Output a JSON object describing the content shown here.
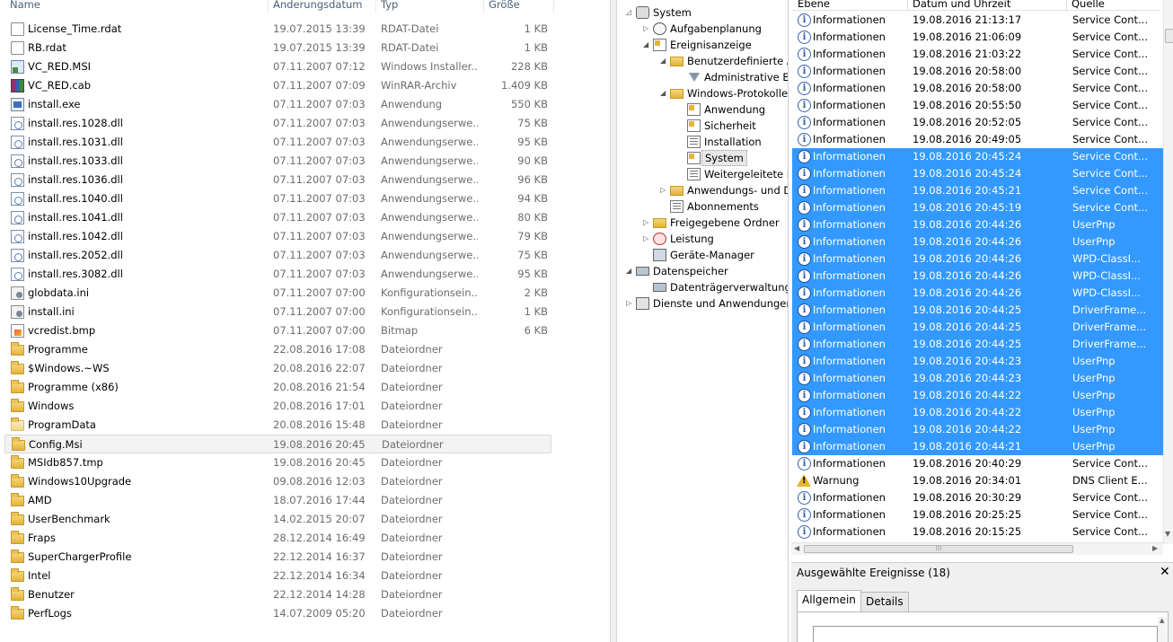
{
  "explorer": {
    "columns": {
      "name": "Name",
      "date": "Änderungsdatum",
      "type": "Typ",
      "size": "Größe"
    },
    "files": [
      {
        "icon": "file-icon",
        "name": "License_Time.rdat",
        "date": "19.07.2015 13:39",
        "type": "RDAT-Datei",
        "size": "1 KB"
      },
      {
        "icon": "file-icon",
        "name": "RB.rdat",
        "date": "19.07.2015 13:39",
        "type": "RDAT-Datei",
        "size": "1 KB"
      },
      {
        "icon": "msi-icon",
        "name": "VC_RED.MSI",
        "date": "07.11.2007 07:12",
        "type": "Windows Installer...",
        "size": "228 KB"
      },
      {
        "icon": "cab-icon",
        "name": "VC_RED.cab",
        "date": "07.11.2007 07:09",
        "type": "WinRAR-Archiv",
        "size": "1.409 KB"
      },
      {
        "icon": "exe-icon",
        "name": "install.exe",
        "date": "07.11.2007 07:03",
        "type": "Anwendung",
        "size": "550 KB"
      },
      {
        "icon": "dll-icon",
        "name": "install.res.1028.dll",
        "date": "07.11.2007 07:03",
        "type": "Anwendungserwe...",
        "size": "75 KB"
      },
      {
        "icon": "dll-icon",
        "name": "install.res.1031.dll",
        "date": "07.11.2007 07:03",
        "type": "Anwendungserwe...",
        "size": "95 KB"
      },
      {
        "icon": "dll-icon",
        "name": "install.res.1033.dll",
        "date": "07.11.2007 07:03",
        "type": "Anwendungserwe...",
        "size": "90 KB"
      },
      {
        "icon": "dll-icon",
        "name": "install.res.1036.dll",
        "date": "07.11.2007 07:03",
        "type": "Anwendungserwe...",
        "size": "96 KB"
      },
      {
        "icon": "dll-icon",
        "name": "install.res.1040.dll",
        "date": "07.11.2007 07:03",
        "type": "Anwendungserwe...",
        "size": "94 KB"
      },
      {
        "icon": "dll-icon",
        "name": "install.res.1041.dll",
        "date": "07.11.2007 07:03",
        "type": "Anwendungserwe...",
        "size": "80 KB"
      },
      {
        "icon": "dll-icon",
        "name": "install.res.1042.dll",
        "date": "07.11.2007 07:03",
        "type": "Anwendungserwe...",
        "size": "79 KB"
      },
      {
        "icon": "dll-icon",
        "name": "install.res.2052.dll",
        "date": "07.11.2007 07:03",
        "type": "Anwendungserwe...",
        "size": "75 KB"
      },
      {
        "icon": "dll-icon",
        "name": "install.res.3082.dll",
        "date": "07.11.2007 07:03",
        "type": "Anwendungserwe...",
        "size": "95 KB"
      },
      {
        "icon": "ini-icon",
        "name": "globdata.ini",
        "date": "07.11.2007 07:00",
        "type": "Konfigurationsein...",
        "size": "2 KB"
      },
      {
        "icon": "ini-icon",
        "name": "install.ini",
        "date": "07.11.2007 07:00",
        "type": "Konfigurationsein...",
        "size": "1 KB"
      },
      {
        "icon": "bmp-icon",
        "name": "vcredist.bmp",
        "date": "07.11.2007 07:00",
        "type": "Bitmap",
        "size": "6 KB"
      },
      {
        "icon": "folder-icon",
        "name": "Programme",
        "date": "22.08.2016 17:08",
        "type": "Dateiordner",
        "size": ""
      },
      {
        "icon": "folder-icon",
        "name": "$Windows.~WS",
        "date": "20.08.2016 22:07",
        "type": "Dateiordner",
        "size": ""
      },
      {
        "icon": "folder-icon",
        "name": "Programme (x86)",
        "date": "20.08.2016 21:54",
        "type": "Dateiordner",
        "size": ""
      },
      {
        "icon": "folder-icon",
        "name": "Windows",
        "date": "20.08.2016 17:01",
        "type": "Dateiordner",
        "size": ""
      },
      {
        "icon": "folder-light-icon",
        "name": "ProgramData",
        "date": "20.08.2016 15:48",
        "type": "Dateiordner",
        "size": ""
      },
      {
        "icon": "folder-icon",
        "name": "Config.Msi",
        "date": "19.08.2016 20:45",
        "type": "Dateiordner",
        "size": "",
        "selected": true
      },
      {
        "icon": "folder-icon",
        "name": "MSIdb857.tmp",
        "date": "19.08.2016 20:45",
        "type": "Dateiordner",
        "size": ""
      },
      {
        "icon": "folder-icon",
        "name": "Windows10Upgrade",
        "date": "09.08.2016 12:03",
        "type": "Dateiordner",
        "size": ""
      },
      {
        "icon": "folder-icon",
        "name": "AMD",
        "date": "18.07.2016 17:44",
        "type": "Dateiordner",
        "size": ""
      },
      {
        "icon": "folder-icon",
        "name": "UserBenchmark",
        "date": "14.02.2015 20:07",
        "type": "Dateiordner",
        "size": ""
      },
      {
        "icon": "folder-icon",
        "name": "Fraps",
        "date": "28.12.2014 16:49",
        "type": "Dateiordner",
        "size": ""
      },
      {
        "icon": "folder-icon",
        "name": "SuperChargerProfile",
        "date": "22.12.2014 16:37",
        "type": "Dateiordner",
        "size": ""
      },
      {
        "icon": "folder-icon",
        "name": "Intel",
        "date": "22.12.2014 16:34",
        "type": "Dateiordner",
        "size": ""
      },
      {
        "icon": "folder-icon",
        "name": "Benutzer",
        "date": "22.12.2014 14:28",
        "type": "Dateiordner",
        "size": ""
      },
      {
        "icon": "folder-icon",
        "name": "PerfLogs",
        "date": "14.07.2009 05:20",
        "type": "Dateiordner",
        "size": ""
      }
    ]
  },
  "tree": {
    "items": [
      {
        "label": "System",
        "icon": "system-tools-icon",
        "expander": "◿",
        "level": 0
      },
      {
        "label": "Aufgabenplanung",
        "icon": "task-scheduler-icon",
        "expander": "▷",
        "level": 1
      },
      {
        "label": "Ereignisanzeige",
        "icon": "event-viewer-icon",
        "expander": "◢",
        "level": 1
      },
      {
        "label": "Benutzerdefinierte A",
        "icon": "folder-icon",
        "expander": "◢",
        "level": 2
      },
      {
        "label": "Administrative E",
        "icon": "filter-icon",
        "expander": "",
        "level": 3
      },
      {
        "label": "Windows-Protokolle",
        "icon": "folder-icon",
        "expander": "◢",
        "level": 2
      },
      {
        "label": "Anwendung",
        "icon": "log-icon",
        "expander": "",
        "level": 3
      },
      {
        "label": "Sicherheit",
        "icon": "log-icon",
        "expander": "",
        "level": 3
      },
      {
        "label": "Installation",
        "icon": "log-plain-icon",
        "expander": "",
        "level": 3
      },
      {
        "label": "System",
        "icon": "log-icon",
        "expander": "",
        "level": 3,
        "selected": true
      },
      {
        "label": "Weitergeleitete E",
        "icon": "log-plain-icon",
        "expander": "",
        "level": 3
      },
      {
        "label": "Anwendungs- und D",
        "icon": "folder-icon",
        "expander": "▷",
        "level": 2
      },
      {
        "label": "Abonnements",
        "icon": "log-plain-icon",
        "expander": "",
        "level": 2
      },
      {
        "label": "Freigegebene Ordner",
        "icon": "shared-folder-icon",
        "expander": "▷",
        "level": 1
      },
      {
        "label": "Leistung",
        "icon": "performance-icon",
        "expander": "▷",
        "level": 1
      },
      {
        "label": "Geräte-Manager",
        "icon": "device-manager-icon",
        "expander": "",
        "level": 1
      },
      {
        "label": "Datenspeicher",
        "icon": "storage-icon",
        "expander": "◢",
        "level": 0
      },
      {
        "label": "Datenträgerverwaltung",
        "icon": "disk-management-icon",
        "expander": "",
        "level": 1
      },
      {
        "label": "Dienste und Anwendungen",
        "icon": "services-icon",
        "expander": "▷",
        "level": 0
      }
    ]
  },
  "events": {
    "columns": {
      "level": "Ebene",
      "date": "Datum und Uhrzeit",
      "source": "Quelle"
    },
    "rows": [
      {
        "level": "Informationen",
        "date": "19.08.2016 21:13:17",
        "source": "Service Cont...",
        "type": "info"
      },
      {
        "level": "Informationen",
        "date": "19.08.2016 21:06:09",
        "source": "Service Cont...",
        "type": "info"
      },
      {
        "level": "Informationen",
        "date": "19.08.2016 21:03:22",
        "source": "Service Cont...",
        "type": "info"
      },
      {
        "level": "Informationen",
        "date": "19.08.2016 20:58:00",
        "source": "Service Cont...",
        "type": "info"
      },
      {
        "level": "Informationen",
        "date": "19.08.2016 20:58:00",
        "source": "Service Cont...",
        "type": "info"
      },
      {
        "level": "Informationen",
        "date": "19.08.2016 20:55:50",
        "source": "Service Cont...",
        "type": "info"
      },
      {
        "level": "Informationen",
        "date": "19.08.2016 20:52:05",
        "source": "Service Cont...",
        "type": "info"
      },
      {
        "level": "Informationen",
        "date": "19.08.2016 20:49:05",
        "source": "Service Cont...",
        "type": "info"
      },
      {
        "level": "Informationen",
        "date": "19.08.2016 20:45:24",
        "source": "Service Cont...",
        "type": "info",
        "selected": true
      },
      {
        "level": "Informationen",
        "date": "19.08.2016 20:45:24",
        "source": "Service Cont...",
        "type": "info",
        "selected": true
      },
      {
        "level": "Informationen",
        "date": "19.08.2016 20:45:21",
        "source": "Service Cont...",
        "type": "info",
        "selected": true
      },
      {
        "level": "Informationen",
        "date": "19.08.2016 20:45:19",
        "source": "Service Cont...",
        "type": "info",
        "selected": true
      },
      {
        "level": "Informationen",
        "date": "19.08.2016 20:44:26",
        "source": "UserPnp",
        "type": "info",
        "selected": true
      },
      {
        "level": "Informationen",
        "date": "19.08.2016 20:44:26",
        "source": "UserPnp",
        "type": "info",
        "selected": true
      },
      {
        "level": "Informationen",
        "date": "19.08.2016 20:44:26",
        "source": "WPD-ClassI...",
        "type": "info",
        "selected": true
      },
      {
        "level": "Informationen",
        "date": "19.08.2016 20:44:26",
        "source": "WPD-ClassI...",
        "type": "info",
        "selected": true
      },
      {
        "level": "Informationen",
        "date": "19.08.2016 20:44:26",
        "source": "WPD-ClassI...",
        "type": "info",
        "selected": true
      },
      {
        "level": "Informationen",
        "date": "19.08.2016 20:44:25",
        "source": "DriverFrame...",
        "type": "info",
        "selected": true
      },
      {
        "level": "Informationen",
        "date": "19.08.2016 20:44:25",
        "source": "DriverFrame...",
        "type": "info",
        "selected": true
      },
      {
        "level": "Informationen",
        "date": "19.08.2016 20:44:25",
        "source": "DriverFrame...",
        "type": "info",
        "selected": true
      },
      {
        "level": "Informationen",
        "date": "19.08.2016 20:44:23",
        "source": "UserPnp",
        "type": "info",
        "selected": true
      },
      {
        "level": "Informationen",
        "date": "19.08.2016 20:44:23",
        "source": "UserPnp",
        "type": "info",
        "selected": true
      },
      {
        "level": "Informationen",
        "date": "19.08.2016 20:44:22",
        "source": "UserPnp",
        "type": "info",
        "selected": true
      },
      {
        "level": "Informationen",
        "date": "19.08.2016 20:44:22",
        "source": "UserPnp",
        "type": "info",
        "selected": true
      },
      {
        "level": "Informationen",
        "date": "19.08.2016 20:44:22",
        "source": "UserPnp",
        "type": "info",
        "selected": true
      },
      {
        "level": "Informationen",
        "date": "19.08.2016 20:44:21",
        "source": "UserPnp",
        "type": "info",
        "selected": true
      },
      {
        "level": "Informationen",
        "date": "19.08.2016 20:40:29",
        "source": "Service Cont...",
        "type": "info"
      },
      {
        "level": "Warnung",
        "date": "19.08.2016 20:34:01",
        "source": "DNS Client E...",
        "type": "warning"
      },
      {
        "level": "Informationen",
        "date": "19.08.2016 20:30:29",
        "source": "Service Cont...",
        "type": "info"
      },
      {
        "level": "Informationen",
        "date": "19.08.2016 20:25:25",
        "source": "Service Cont...",
        "type": "info"
      },
      {
        "level": "Informationen",
        "date": "19.08.2016 20:15:25",
        "source": "Service Cont...",
        "type": "info"
      }
    ]
  },
  "details": {
    "title": "Ausgewählte Ereignisse (18)",
    "close": "✕",
    "tabs": [
      "Allgemein",
      "Details"
    ]
  },
  "colors": {
    "selection": "#3399ff",
    "warning": "#e8b52a",
    "info": "#2d5fb1"
  }
}
